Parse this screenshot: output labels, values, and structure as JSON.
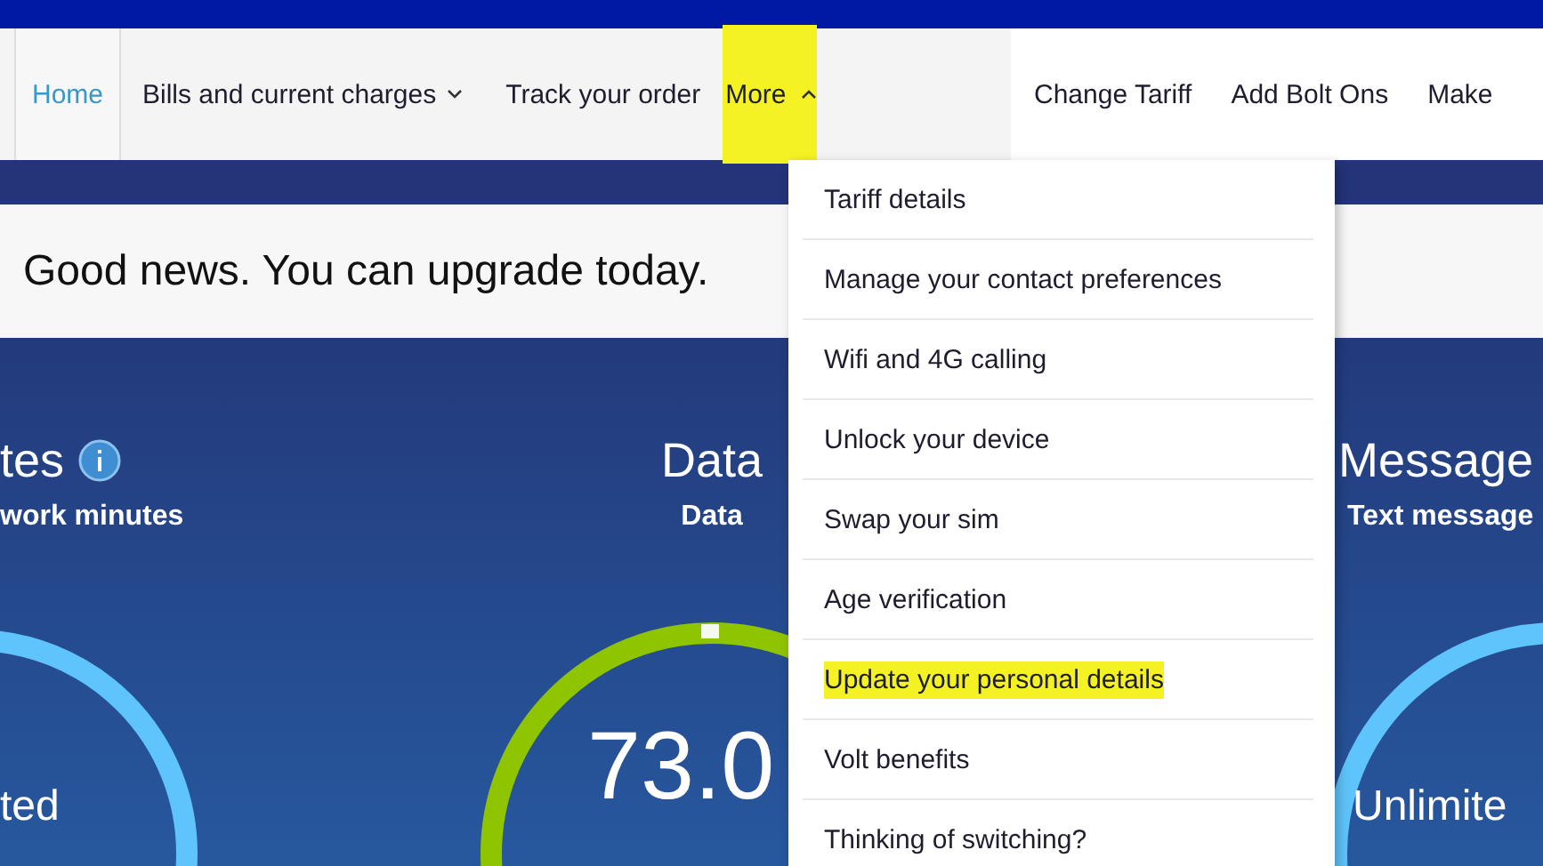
{
  "nav": {
    "items": [
      {
        "label": "Home",
        "kind": "link",
        "selected": true,
        "highlighted": false
      },
      {
        "label": "Bills and current charges",
        "kind": "menu",
        "selected": false,
        "highlighted": false,
        "expanded": false
      },
      {
        "label": "Track your order",
        "kind": "link",
        "selected": false,
        "highlighted": false
      },
      {
        "label": "More",
        "kind": "menu",
        "selected": false,
        "highlighted": true,
        "expanded": true
      }
    ],
    "links": [
      "Change Tariff",
      "Add Bolt Ons",
      "Make"
    ]
  },
  "banner": {
    "text": "Good news. You can upgrade today."
  },
  "more_menu": {
    "items": [
      {
        "label": "Tariff details",
        "highlighted": false
      },
      {
        "label": "Manage your contact preferences",
        "highlighted": false
      },
      {
        "label": "Wifi and 4G calling",
        "highlighted": false
      },
      {
        "label": "Unlock your device",
        "highlighted": false
      },
      {
        "label": "Swap your sim",
        "highlighted": false
      },
      {
        "label": "Age verification",
        "highlighted": false
      },
      {
        "label": "Update your personal details",
        "highlighted": true
      },
      {
        "label": "Volt benefits",
        "highlighted": false
      },
      {
        "label": "Thinking of switching?",
        "highlighted": false
      }
    ]
  },
  "usage": [
    {
      "title": "tes",
      "subtitle": "work minutes",
      "value": "ted"
    },
    {
      "title": "Data",
      "subtitle": "Data",
      "value": "73.0"
    },
    {
      "title": "Message",
      "subtitle": "Text message",
      "value": "Unlimite"
    }
  ]
}
